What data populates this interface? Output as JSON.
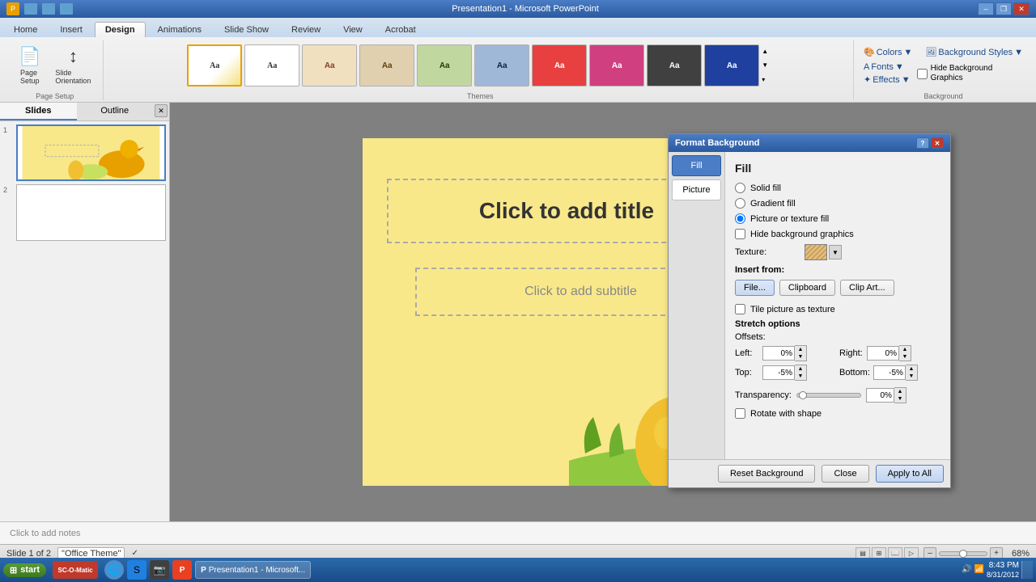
{
  "window": {
    "title": "Presentation1 - Microsoft PowerPoint"
  },
  "titlebar": {
    "minimize": "–",
    "restore": "❐",
    "close": "✕"
  },
  "ribbon": {
    "tabs": [
      "Home",
      "Insert",
      "Design",
      "Animations",
      "Slide Show",
      "Review",
      "View",
      "Acrobat"
    ],
    "active_tab": "Design",
    "groups": {
      "page_setup": {
        "label": "Page Setup",
        "buttons": [
          "Page Setup",
          "Slide Orientation"
        ]
      },
      "themes": {
        "label": "Themes"
      },
      "background": {
        "label": "Background",
        "colors": "Colors",
        "fonts": "Fonts",
        "effects": "Effects",
        "background_styles": "Background Styles",
        "hide_background_graphics": "Hide Background Graphics"
      }
    }
  },
  "sidebar": {
    "tabs": [
      "Slides",
      "Outline"
    ],
    "active_tab": "Slides",
    "slides": [
      {
        "num": "1",
        "has_content": true
      },
      {
        "num": "2",
        "has_content": false
      }
    ]
  },
  "slide": {
    "title_placeholder": "Click to add title",
    "subtitle_placeholder": "Click to add subtitle"
  },
  "notes": {
    "placeholder": "Click to add notes"
  },
  "dialog": {
    "title": "Format Background",
    "sidebar_items": [
      "Fill",
      "Picture"
    ],
    "active_item": "Fill",
    "section_title": "Fill",
    "fill_options": {
      "solid_fill": "Solid fill",
      "gradient_fill": "Gradient fill",
      "picture_or_texture": "Picture or texture fill",
      "selected": "picture_or_texture"
    },
    "hide_background_graphics": "Hide background graphics",
    "texture_label": "Texture:",
    "insert_from_label": "Insert from:",
    "file_btn": "File...",
    "clipboard_btn": "Clipboard",
    "clip_art_btn": "Clip Art...",
    "tile_picture": "Tile picture as texture",
    "stretch_options": "Stretch options",
    "offsets_label": "Offsets:",
    "left_label": "Left:",
    "left_value": "0%",
    "right_label": "Right:",
    "right_value": "0%",
    "top_label": "Top:",
    "top_value": "-5%",
    "bottom_label": "Bottom:",
    "bottom_value": "-5%",
    "transparency_label": "Transparency:",
    "transparency_value": "0%",
    "rotate_with_shape": "Rotate with shape",
    "reset_btn": "Reset Background",
    "close_btn": "Close",
    "apply_all_btn": "Apply to All"
  },
  "status_bar": {
    "slide_info": "Slide 1 of 2",
    "theme": "\"Office Theme\"",
    "zoom": "68%"
  },
  "taskbar": {
    "time": "8:43 PM",
    "date": "8/31/2012",
    "start_label": "start",
    "app_label": "Presentation1 - Microsoft..."
  }
}
